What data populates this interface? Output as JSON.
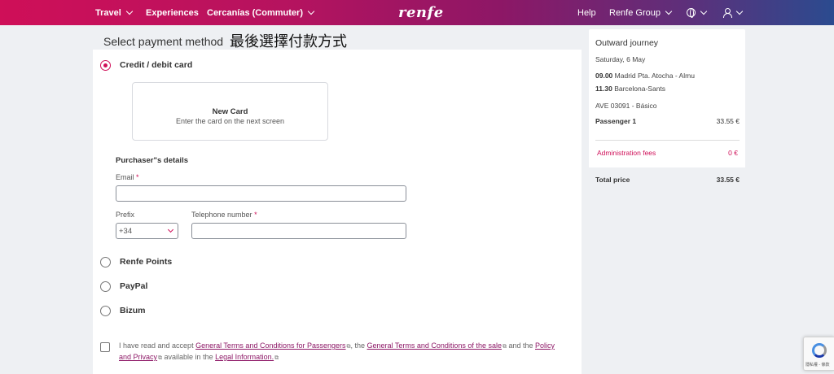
{
  "nav": {
    "travel": "Travel",
    "experiences": "Experiences",
    "commuter": "Cercanías (Commuter)",
    "logo": "renfe",
    "help": "Help",
    "group": "Renfe Group"
  },
  "main": {
    "title": "Select payment method",
    "title_cn": "最後選擇付款方式",
    "credit": "Credit / debit card",
    "new_card_title": "New Card",
    "new_card_sub": "Enter the card on the next screen",
    "purchaser": "Purchaser\"s details",
    "email_label": "Email",
    "prefix_label": "Prefix",
    "prefix_value": "+34",
    "phone_label": "Telephone number",
    "required_mark": "*",
    "points": "Renfe Points",
    "paypal": "PayPal",
    "bizum": "Bizum",
    "terms": {
      "t1": "I have read and accept ",
      "l1": "General Terms and Conditions for Passengers",
      "t2": ", the ",
      "l2": "General Terms and Conditions of the sale",
      "t3": " and the ",
      "l3": "Policy and Privacy",
      "t4": " available in the ",
      "l4": "Legal Information."
    }
  },
  "summary": {
    "title": "Outward journey",
    "date": "Saturday, 6 May",
    "dep_time": "09.00",
    "dep_station": "Madrid Pta. Atocha - Almu",
    "arr_time": "11.30",
    "arr_station": "Barcelona-Sants",
    "train": "AVE 03091 - Básico",
    "passenger_label": "Passenger 1",
    "passenger_price": "33.55 €",
    "fees_label": "Administration fees",
    "fees_price": "0 €",
    "total_label": "Total price",
    "total_price": "33.55 €"
  },
  "recaptcha": {
    "text": "隱私權 - 條款"
  },
  "colors": {
    "accent": "#cf0f58",
    "link": "#8d1766"
  },
  "icons": [
    "chevron-down-icon",
    "globe-icon",
    "user-icon",
    "external-link-icon",
    "recaptcha-icon"
  ]
}
